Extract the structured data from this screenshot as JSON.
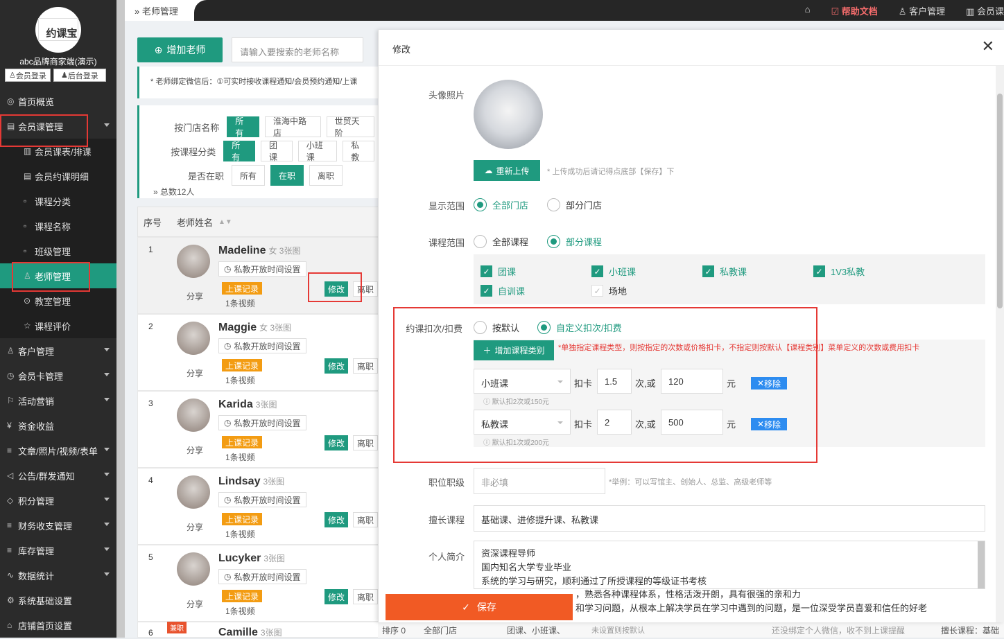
{
  "sidebar": {
    "logo_text": "约课宝",
    "brand": "abc品牌商家端(演示)",
    "member_login": "会员登录",
    "admin_login": "后台登录",
    "items": [
      {
        "label": "首页概览",
        "icon": "globe-icon"
      },
      {
        "label": "会员课管理",
        "icon": "document-icon"
      },
      {
        "label": "会员课表/排课",
        "icon": "book-icon"
      },
      {
        "label": "会员约课明细",
        "icon": "list-icon"
      },
      {
        "label": "课程分类",
        "icon": "file-icon"
      },
      {
        "label": "课程名称",
        "icon": "file-icon"
      },
      {
        "label": "班级管理",
        "icon": "file-icon"
      },
      {
        "label": "老师管理",
        "icon": "user-icon"
      },
      {
        "label": "教室管理",
        "icon": "location-icon"
      },
      {
        "label": "课程评价",
        "icon": "star-icon"
      },
      {
        "label": "客户管理",
        "icon": "user-icon"
      },
      {
        "label": "会员卡管理",
        "icon": "clock-icon"
      },
      {
        "label": "活动营销",
        "icon": "flag-icon"
      },
      {
        "label": "资金收益",
        "icon": "yen-icon"
      },
      {
        "label": "文章/照片/视频/表单",
        "icon": "sliders-icon"
      },
      {
        "label": "公告/群发通知",
        "icon": "megaphone-icon"
      },
      {
        "label": "积分管理",
        "icon": "diamond-icon"
      },
      {
        "label": "财务收支管理",
        "icon": "sliders-icon"
      },
      {
        "label": "库存管理",
        "icon": "sliders-icon"
      },
      {
        "label": "数据统计",
        "icon": "chart-icon"
      },
      {
        "label": "系统基础设置",
        "icon": "gear-icon"
      },
      {
        "label": "店铺首页设置",
        "icon": "shop-icon"
      }
    ]
  },
  "topbar": {
    "breadcrumb": "老师管理",
    "help": "帮助文档",
    "customer": "客户管理",
    "member_course": "会员课"
  },
  "toolbar": {
    "add_teacher": "增加老师",
    "search_placeholder": "请输入要搜索的老师名称",
    "notice": "* 老师绑定微信后：①可实时接收课程通知/会员预约通知/上课"
  },
  "filters": {
    "store_label": "按门店名称",
    "store_options": [
      "所有",
      "淮海中路店",
      "世贸天阶"
    ],
    "course_label": "按课程分类",
    "course_options": [
      "所有",
      "团课",
      "小班课",
      "私教"
    ],
    "status_label": "是否在职",
    "status_options": [
      "所有",
      "在职",
      "离职"
    ],
    "total": "总数12人"
  },
  "table": {
    "col_no": "序号",
    "col_name": "老师姓名",
    "time_setting": "私教开放时间设置",
    "record": "上课记录",
    "share": "分享",
    "edit": "修改",
    "quit": "离职",
    "rows": [
      {
        "no": "1",
        "name": "Madeline",
        "meta": "女 3张图",
        "video": "1条视频"
      },
      {
        "no": "2",
        "name": "Maggie",
        "meta": "女 3张图",
        "video": "1条视频"
      },
      {
        "no": "3",
        "name": "Karida",
        "meta": "3张图",
        "video": "1条视频"
      },
      {
        "no": "4",
        "name": "Lindsay",
        "meta": "3张图",
        "video": "1条视频"
      },
      {
        "no": "5",
        "name": "Lucyker",
        "meta": "3张图",
        "video": "1条视频"
      },
      {
        "no": "6",
        "name": "Camille",
        "meta": "3张图",
        "badge": "兼职"
      }
    ]
  },
  "bottom_strip": {
    "sort": "排序 0",
    "stores": "全部门店",
    "courses": "团课、小班课、",
    "unset": "未设置则按默认",
    "wechat": "还没绑定个人微信，收不到上课提醒",
    "skill": "擅长课程：基础"
  },
  "modal": {
    "title": "修改",
    "photo_label": "头像照片",
    "reupload": "重新上传",
    "upload_hint": "* 上传成功后请记得点底部【保存】下",
    "scope_label": "显示范围",
    "scope_all": "全部门店",
    "scope_part": "部分门店",
    "course_scope_label": "课程范围",
    "course_all": "全部课程",
    "course_part": "部分课程",
    "course_checks": [
      {
        "label": "团课",
        "checked": true
      },
      {
        "label": "小班课",
        "checked": true
      },
      {
        "label": "私教课",
        "checked": true
      },
      {
        "label": "1V3私教",
        "checked": true
      },
      {
        "label": "自训课",
        "checked": true
      },
      {
        "label": "场地",
        "checked": false
      }
    ],
    "deduct_label": "约课扣次/扣费",
    "deduct_default": "按默认",
    "deduct_custom": "自定义扣次/扣费",
    "add_category": "增加课程类别",
    "deduct_hint": "*单独指定课程类型，则按指定的次数或价格扣卡，不指定则按默认【课程类别】菜单定义的次数或费用扣卡",
    "deduct_rows": [
      {
        "course": "小班课",
        "count": "1.5",
        "price": "120",
        "default_hint": "默认扣2次或150元"
      },
      {
        "course": "私教课",
        "count": "2",
        "price": "500",
        "default_hint": "默认扣1次或200元"
      }
    ],
    "deduct_card": "扣卡",
    "times_or": "次,或",
    "yuan": "元",
    "remove": "移除",
    "position_label": "职位职级",
    "position_placeholder": "非必填",
    "position_hint": "*举例：可以写馆主、创始人、总监、高级老师等",
    "skill_label": "擅长课程",
    "skill_value": "基础课、进修提升课、私教课",
    "intro_label": "个人简介",
    "intro_lines": [
      "资深课程导师",
      "国内知名大学专业毕业",
      "系统的学习与研究，顺利通过了所授课程的等级证书考核",
      "，熟悉各种课程体系，性格活泼开朗，具有很强的亲和力",
      "和学习问题，从根本上解决学员在学习中遇到的问题，是一位深受学员喜爱和信任的好老"
    ],
    "save": "保存"
  },
  "colors": {
    "primary": "#1f9a7f",
    "danger": "#e53935",
    "save": "#f15a24",
    "remove": "#2d8cf0"
  }
}
